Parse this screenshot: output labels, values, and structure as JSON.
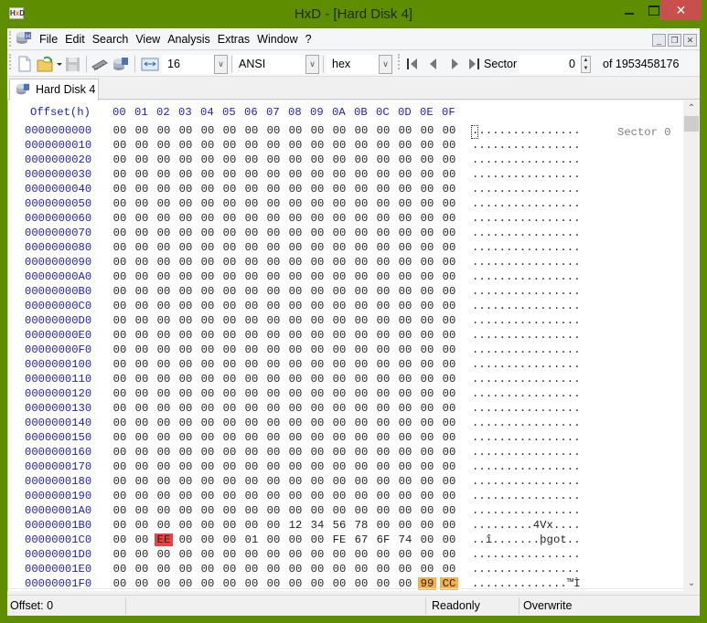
{
  "window": {
    "title": "HxD - [Hard Disk 4]",
    "app_icon": "hxd-logo",
    "controls": {
      "minimize": "minimize-icon",
      "maximize": "maximize-icon",
      "close": "✕"
    }
  },
  "menu": {
    "items": [
      "File",
      "Edit",
      "Search",
      "View",
      "Analysis",
      "Extras",
      "Window",
      "?"
    ],
    "mdi_controls": [
      "_",
      "❐",
      "✕"
    ]
  },
  "toolbar": {
    "bytes_per_row": "16",
    "charset": "ANSI",
    "offset_base": "hex",
    "sector_label": "Sector",
    "sector_value": "0",
    "sector_total": "of 1953458176",
    "icons": [
      "new-file-icon",
      "open-file-icon",
      "dropdown-arrow-icon",
      "save-icon",
      "open-ram-icon",
      "open-disk-icon",
      "bytes-per-row-icon",
      "first-sector-icon",
      "previous-sector-icon",
      "next-sector-icon",
      "last-sector-icon"
    ]
  },
  "tabs": [
    {
      "label": "Hard Disk 4",
      "active": true
    }
  ],
  "editor": {
    "header_offset": "Offset(h)",
    "header_columns": [
      "00",
      "01",
      "02",
      "03",
      "04",
      "05",
      "06",
      "07",
      "08",
      "09",
      "0A",
      "0B",
      "0C",
      "0D",
      "0E",
      "0F"
    ],
    "sector_label": "Sector 0",
    "rows": [
      {
        "offset": "0000000000",
        "bytes": [
          "00",
          "00",
          "00",
          "00",
          "00",
          "00",
          "00",
          "00",
          "00",
          "00",
          "00",
          "00",
          "00",
          "00",
          "00",
          "00"
        ],
        "ascii": "................"
      },
      {
        "offset": "0000000010",
        "bytes": [
          "00",
          "00",
          "00",
          "00",
          "00",
          "00",
          "00",
          "00",
          "00",
          "00",
          "00",
          "00",
          "00",
          "00",
          "00",
          "00"
        ],
        "ascii": "................"
      },
      {
        "offset": "0000000020",
        "bytes": [
          "00",
          "00",
          "00",
          "00",
          "00",
          "00",
          "00",
          "00",
          "00",
          "00",
          "00",
          "00",
          "00",
          "00",
          "00",
          "00"
        ],
        "ascii": "................"
      },
      {
        "offset": "0000000030",
        "bytes": [
          "00",
          "00",
          "00",
          "00",
          "00",
          "00",
          "00",
          "00",
          "00",
          "00",
          "00",
          "00",
          "00",
          "00",
          "00",
          "00"
        ],
        "ascii": "................"
      },
      {
        "offset": "0000000040",
        "bytes": [
          "00",
          "00",
          "00",
          "00",
          "00",
          "00",
          "00",
          "00",
          "00",
          "00",
          "00",
          "00",
          "00",
          "00",
          "00",
          "00"
        ],
        "ascii": "................"
      },
      {
        "offset": "0000000050",
        "bytes": [
          "00",
          "00",
          "00",
          "00",
          "00",
          "00",
          "00",
          "00",
          "00",
          "00",
          "00",
          "00",
          "00",
          "00",
          "00",
          "00"
        ],
        "ascii": "................"
      },
      {
        "offset": "0000000060",
        "bytes": [
          "00",
          "00",
          "00",
          "00",
          "00",
          "00",
          "00",
          "00",
          "00",
          "00",
          "00",
          "00",
          "00",
          "00",
          "00",
          "00"
        ],
        "ascii": "................"
      },
      {
        "offset": "0000000070",
        "bytes": [
          "00",
          "00",
          "00",
          "00",
          "00",
          "00",
          "00",
          "00",
          "00",
          "00",
          "00",
          "00",
          "00",
          "00",
          "00",
          "00"
        ],
        "ascii": "................"
      },
      {
        "offset": "0000000080",
        "bytes": [
          "00",
          "00",
          "00",
          "00",
          "00",
          "00",
          "00",
          "00",
          "00",
          "00",
          "00",
          "00",
          "00",
          "00",
          "00",
          "00"
        ],
        "ascii": "................"
      },
      {
        "offset": "0000000090",
        "bytes": [
          "00",
          "00",
          "00",
          "00",
          "00",
          "00",
          "00",
          "00",
          "00",
          "00",
          "00",
          "00",
          "00",
          "00",
          "00",
          "00"
        ],
        "ascii": "................"
      },
      {
        "offset": "00000000A0",
        "bytes": [
          "00",
          "00",
          "00",
          "00",
          "00",
          "00",
          "00",
          "00",
          "00",
          "00",
          "00",
          "00",
          "00",
          "00",
          "00",
          "00"
        ],
        "ascii": "................"
      },
      {
        "offset": "00000000B0",
        "bytes": [
          "00",
          "00",
          "00",
          "00",
          "00",
          "00",
          "00",
          "00",
          "00",
          "00",
          "00",
          "00",
          "00",
          "00",
          "00",
          "00"
        ],
        "ascii": "................"
      },
      {
        "offset": "00000000C0",
        "bytes": [
          "00",
          "00",
          "00",
          "00",
          "00",
          "00",
          "00",
          "00",
          "00",
          "00",
          "00",
          "00",
          "00",
          "00",
          "00",
          "00"
        ],
        "ascii": "................"
      },
      {
        "offset": "00000000D0",
        "bytes": [
          "00",
          "00",
          "00",
          "00",
          "00",
          "00",
          "00",
          "00",
          "00",
          "00",
          "00",
          "00",
          "00",
          "00",
          "00",
          "00"
        ],
        "ascii": "................"
      },
      {
        "offset": "00000000E0",
        "bytes": [
          "00",
          "00",
          "00",
          "00",
          "00",
          "00",
          "00",
          "00",
          "00",
          "00",
          "00",
          "00",
          "00",
          "00",
          "00",
          "00"
        ],
        "ascii": "................"
      },
      {
        "offset": "00000000F0",
        "bytes": [
          "00",
          "00",
          "00",
          "00",
          "00",
          "00",
          "00",
          "00",
          "00",
          "00",
          "00",
          "00",
          "00",
          "00",
          "00",
          "00"
        ],
        "ascii": "................"
      },
      {
        "offset": "0000000100",
        "bytes": [
          "00",
          "00",
          "00",
          "00",
          "00",
          "00",
          "00",
          "00",
          "00",
          "00",
          "00",
          "00",
          "00",
          "00",
          "00",
          "00"
        ],
        "ascii": "................"
      },
      {
        "offset": "0000000110",
        "bytes": [
          "00",
          "00",
          "00",
          "00",
          "00",
          "00",
          "00",
          "00",
          "00",
          "00",
          "00",
          "00",
          "00",
          "00",
          "00",
          "00"
        ],
        "ascii": "................"
      },
      {
        "offset": "0000000120",
        "bytes": [
          "00",
          "00",
          "00",
          "00",
          "00",
          "00",
          "00",
          "00",
          "00",
          "00",
          "00",
          "00",
          "00",
          "00",
          "00",
          "00"
        ],
        "ascii": "................"
      },
      {
        "offset": "0000000130",
        "bytes": [
          "00",
          "00",
          "00",
          "00",
          "00",
          "00",
          "00",
          "00",
          "00",
          "00",
          "00",
          "00",
          "00",
          "00",
          "00",
          "00"
        ],
        "ascii": "................"
      },
      {
        "offset": "0000000140",
        "bytes": [
          "00",
          "00",
          "00",
          "00",
          "00",
          "00",
          "00",
          "00",
          "00",
          "00",
          "00",
          "00",
          "00",
          "00",
          "00",
          "00"
        ],
        "ascii": "................"
      },
      {
        "offset": "0000000150",
        "bytes": [
          "00",
          "00",
          "00",
          "00",
          "00",
          "00",
          "00",
          "00",
          "00",
          "00",
          "00",
          "00",
          "00",
          "00",
          "00",
          "00"
        ],
        "ascii": "................"
      },
      {
        "offset": "0000000160",
        "bytes": [
          "00",
          "00",
          "00",
          "00",
          "00",
          "00",
          "00",
          "00",
          "00",
          "00",
          "00",
          "00",
          "00",
          "00",
          "00",
          "00"
        ],
        "ascii": "................"
      },
      {
        "offset": "0000000170",
        "bytes": [
          "00",
          "00",
          "00",
          "00",
          "00",
          "00",
          "00",
          "00",
          "00",
          "00",
          "00",
          "00",
          "00",
          "00",
          "00",
          "00"
        ],
        "ascii": "................"
      },
      {
        "offset": "0000000180",
        "bytes": [
          "00",
          "00",
          "00",
          "00",
          "00",
          "00",
          "00",
          "00",
          "00",
          "00",
          "00",
          "00",
          "00",
          "00",
          "00",
          "00"
        ],
        "ascii": "................"
      },
      {
        "offset": "0000000190",
        "bytes": [
          "00",
          "00",
          "00",
          "00",
          "00",
          "00",
          "00",
          "00",
          "00",
          "00",
          "00",
          "00",
          "00",
          "00",
          "00",
          "00"
        ],
        "ascii": "................"
      },
      {
        "offset": "00000001A0",
        "bytes": [
          "00",
          "00",
          "00",
          "00",
          "00",
          "00",
          "00",
          "00",
          "00",
          "00",
          "00",
          "00",
          "00",
          "00",
          "00",
          "00"
        ],
        "ascii": "................"
      },
      {
        "offset": "00000001B0",
        "bytes": [
          "00",
          "00",
          "00",
          "00",
          "00",
          "00",
          "00",
          "00",
          "12",
          "34",
          "56",
          "78",
          "00",
          "00",
          "00",
          "00"
        ],
        "ascii": ".........4Vx...."
      },
      {
        "offset": "00000001C0",
        "bytes": [
          "00",
          "00",
          "EE",
          "00",
          "00",
          "00",
          "01",
          "00",
          "00",
          "00",
          "FE",
          "67",
          "6F",
          "74",
          "00",
          "00"
        ],
        "ascii": "..î.......þgot.."
      },
      {
        "offset": "00000001D0",
        "bytes": [
          "00",
          "00",
          "00",
          "00",
          "00",
          "00",
          "00",
          "00",
          "00",
          "00",
          "00",
          "00",
          "00",
          "00",
          "00",
          "00"
        ],
        "ascii": "................"
      },
      {
        "offset": "00000001E0",
        "bytes": [
          "00",
          "00",
          "00",
          "00",
          "00",
          "00",
          "00",
          "00",
          "00",
          "00",
          "00",
          "00",
          "00",
          "00",
          "00",
          "00"
        ],
        "ascii": "................"
      },
      {
        "offset": "00000001F0",
        "bytes": [
          "00",
          "00",
          "00",
          "00",
          "00",
          "00",
          "00",
          "00",
          "00",
          "00",
          "00",
          "00",
          "00",
          "00",
          "99",
          "CC"
        ],
        "ascii": "..............™Ì"
      }
    ],
    "highlights": [
      {
        "row": 28,
        "col": 2,
        "color": "#f04040"
      },
      {
        "row": 31,
        "col": 14,
        "color": "#f7b048"
      },
      {
        "row": 31,
        "col": 15,
        "color": "#f7b048"
      }
    ]
  },
  "statusbar": {
    "offset": "Offset: 0",
    "empty": "",
    "mode": "Readonly",
    "edit_mode": "Overwrite"
  },
  "colors": {
    "window_frame": "#5e8e00",
    "offset_text": "#2020b8",
    "highlight_red": "#f04040",
    "highlight_orange": "#f7b048",
    "close_button": "#c7504f"
  }
}
